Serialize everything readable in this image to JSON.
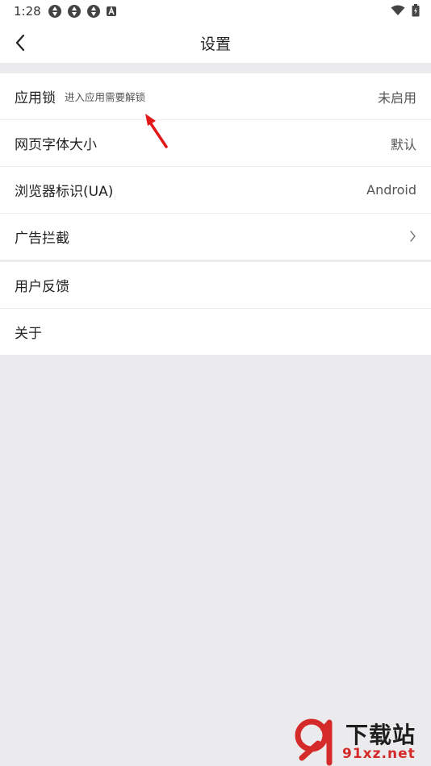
{
  "status_bar": {
    "time": "1:28",
    "icons": [
      "app-icon",
      "app-icon",
      "app-icon",
      "a-icon"
    ],
    "right_icons": [
      "wifi-icon",
      "battery-charging-icon"
    ]
  },
  "header": {
    "title": "设置",
    "back_icon": "chevron-left-icon"
  },
  "settings": {
    "group1": [
      {
        "label": "应用锁",
        "subtitle": "进入应用需要解锁",
        "value": "未启用"
      },
      {
        "label": "网页字体大小",
        "value": "默认"
      },
      {
        "label": "浏览器标识(UA)",
        "value": "Android"
      },
      {
        "label": "广告拦截",
        "icon": "chevron-right-icon"
      }
    ],
    "group2": [
      {
        "label": "用户反馈"
      },
      {
        "label": "关于"
      }
    ]
  },
  "watermark": {
    "title": "下载站",
    "url": "91xz.net"
  },
  "colors": {
    "background": "#ebebed",
    "surface": "#ffffff",
    "annotation_arrow": "#e01818",
    "watermark_red": "#d42a2a"
  }
}
